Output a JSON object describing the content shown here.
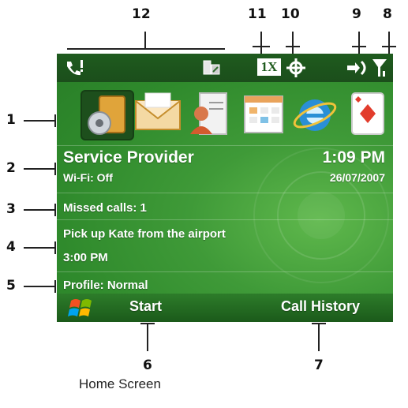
{
  "callouts": {
    "c1": "1",
    "c2": "2",
    "c3": "3",
    "c4": "4",
    "c5": "5",
    "c6": "6",
    "c7": "7",
    "c8": "8",
    "c9": "9",
    "c10": "10",
    "c11": "11",
    "c12": "12"
  },
  "status_bar": {
    "network_badge": "1X",
    "icons": [
      "phone-missed-call-icon",
      "sync-icon",
      "1x-network-icon",
      "gps-icon",
      "data-connection-icon",
      "signal-strength-icon"
    ]
  },
  "today": {
    "provider": "Service Provider",
    "wifi": "Wi-Fi: Off",
    "time": "1:09 PM",
    "date": "26/07/2007",
    "missed_calls": "Missed calls: 1",
    "appointment_title": "Pick up Kate from the airport",
    "appointment_time": "3:00 PM",
    "profile": "Profile: Normal"
  },
  "apps": [
    {
      "name": "settings-icon"
    },
    {
      "name": "messaging-icon"
    },
    {
      "name": "contacts-icon"
    },
    {
      "name": "calendar-icon"
    },
    {
      "name": "internet-explorer-icon"
    },
    {
      "name": "solitaire-icon"
    }
  ],
  "softkeys": {
    "left": "Start",
    "right": "Call History"
  },
  "caption": "Home Screen",
  "colors": {
    "screen_green": "#3f9a38",
    "status_bar": "#1f5b1e",
    "softkey_bar": "#1b5a1a",
    "text": "#ffffff"
  }
}
